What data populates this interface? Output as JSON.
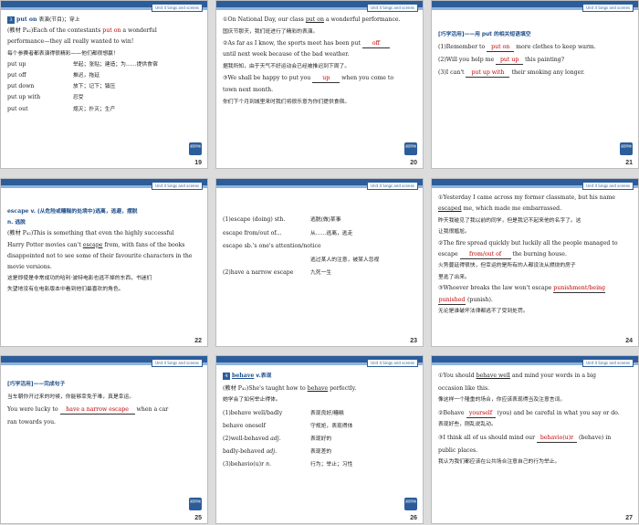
{
  "unit_tag": "Unit 4  Sings and scenes",
  "corner_button": "返回导航",
  "slides": [
    {
      "page": "19",
      "lines": [
        "put on   表演(节目)；穿上",
        "(教材 P₄₂)Each of the contestants put on a wonderful",
        "performance—they all really wanted to win!",
        "每个参赛者都表演得很精彩——他们都很想赢！",
        "put up        举起；张贴；建造；为……提供食宿",
        "put off        推迟，拖延",
        "put down      放下；记下；镇压",
        "put up with    忍受",
        "put out        熄灭；扑灭；生产"
      ]
    },
    {
      "page": "20",
      "lines": [
        "①On National Day, our class put on a wonderful performance.",
        "国庆节那天，我们班进行了精彩的表演。",
        "②As far as I know, the sports meet has been put off",
        "until next week because of the bad weather.",
        "据我所知，由于天气不好运动会已经被推迟到下周了。",
        "③We shall be happy to put you up when you come to",
        "town next month.",
        "你们下个月到城里来时我们将很乐意为你们提供食宿。"
      ],
      "answers": [
        "off",
        "up"
      ]
    },
    {
      "page": "21",
      "lines": [
        "[巧学活用]——用 put 的相关短语填空",
        "(1)Remember to put on more clothes to keep warm.",
        "(2)Will you help me put up this painting?",
        "(3)I can't put up with their smoking any longer."
      ],
      "answers": [
        "put on",
        "put up",
        "put up with"
      ]
    },
    {
      "page": "22",
      "lines": [
        "escape   v. (从危险或糟糕的处境中)逃离，逃避，摆脱",
        "n. 逃脱",
        "(教材 P₄₂)This is something that even the highly successful",
        "Harry Potter movies can't escape from, with fans of the books",
        "disappointed not to see some of their favourite characters in the",
        "movie versions.",
        "这是即使是非常成功的哈利·波特电影也逃不掉的东西，书迷们",
        "失望地没有在电影版本中看到他们最喜欢的角色。"
      ]
    },
    {
      "page": "23",
      "lines": [
        "(1)escape (doing) sth.        逃脱(做)某事",
        "escape from/out of...         从……逃离，逃走",
        "escape sb.'s one's attention/notice",
        "                              逃过某人的注意，被某人忽视",
        "(2)have a narrow escape       九死一生"
      ]
    },
    {
      "page": "24",
      "lines": [
        "①Yesterday I came across my former classmate, but his name",
        "escaped me, which made me embarrassed.",
        "昨天我碰见了我以前的同学，但是我记不起来他的名字了。这",
        "让我很尴尬。",
        "②The fire spread quickly but luckily all the people managed to",
        "escape from/out of the burning house.",
        "火势蔓延得很快，但幸运的是所有的人都设法从燃烧的房子",
        "里逃了出来。",
        "③Whoever breaks the law won't escape punishment/being",
        "punished (punish).",
        "无论是谁破坏法律都逃不了受到处罚。"
      ],
      "answers": [
        "from/out of",
        "punishment/being",
        "punished"
      ]
    },
    {
      "page": "25",
      "lines": [
        "[巧学活用]——完成句子",
        "当车朝你开过来的时候，你能够幸免于难，真是幸运。",
        "You were lucky to have a narrow escape when a car",
        "ran towards you."
      ],
      "answers": [
        "have a narrow escape"
      ]
    },
    {
      "page": "26",
      "lines": [
        "behave   v.表现",
        "(教材 P₄₂)She's taught how to behave perfectly.",
        "她学会了如何举止得体。",
        "(1)behave well/badly          表现良好/糟糕",
        "behave oneself                守规矩，表现得体",
        "(2)well-behaved adj.          表现好的",
        "badly-behaved adj.            表现差的",
        "(3)behavio(u)r n.             行为；举止；习性"
      ]
    },
    {
      "page": "27",
      "lines": [
        "①You should behave well and mind your words in a big",
        "occasion like this.",
        "像这样一个隆重的场合，你应该表现得当及注意言词。",
        "②Behave yourself (you) and be careful in what you say or do.",
        "表现好些，刚乱说乱动。",
        "③I think all of us should mind our behavio(u)r (behave) in",
        "public places.",
        "我认为我们都应该在公共场合注意自己的行为举止。"
      ],
      "answers": [
        "yourself",
        "behavio(u)r"
      ]
    }
  ]
}
